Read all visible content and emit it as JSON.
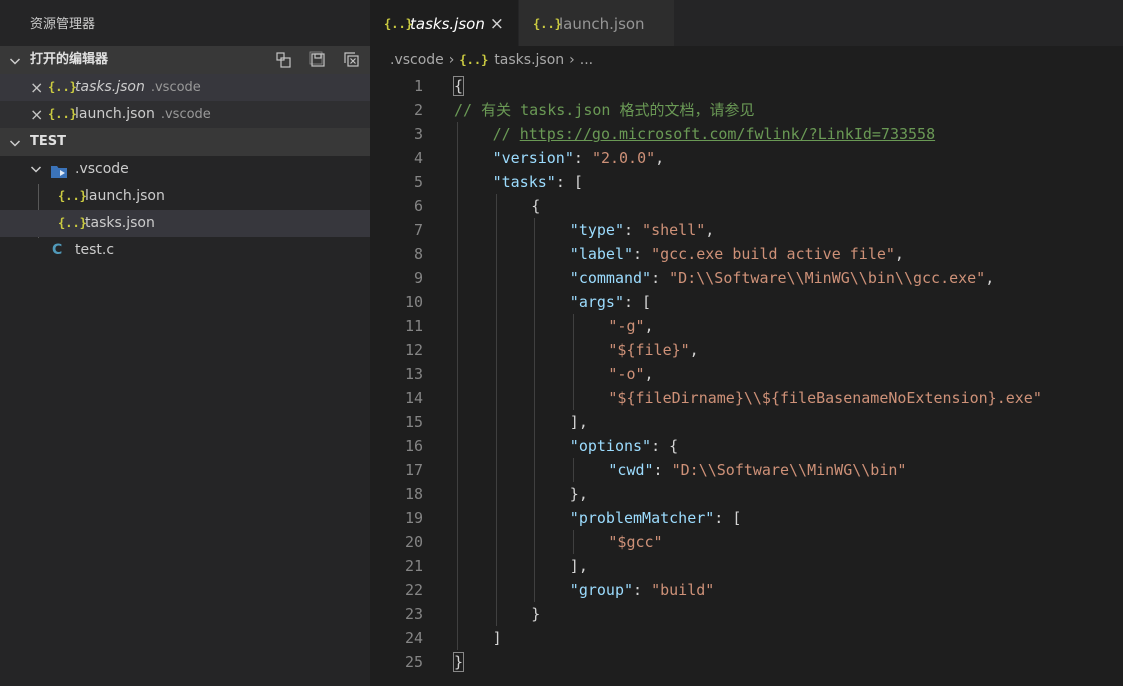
{
  "sidebar": {
    "title": "资源管理器",
    "open_editors": {
      "label": "打开的编辑器",
      "items": [
        {
          "name": "tasks.json",
          "dir": ".vscode"
        },
        {
          "name": "launch.json",
          "dir": ".vscode"
        }
      ]
    },
    "workspace": {
      "label": "TEST",
      "folder": ".vscode",
      "folder_children": [
        "launch.json",
        "tasks.json"
      ],
      "files": [
        "test.c"
      ]
    }
  },
  "tabs": [
    {
      "label": "tasks.json",
      "active": true
    },
    {
      "label": "launch.json",
      "active": false
    }
  ],
  "breadcrumb": {
    "folder": ".vscode",
    "file": "tasks.json",
    "more": "..."
  },
  "editor": {
    "lines": [
      {
        "n": "1",
        "p1": "{"
      },
      {
        "n": "2",
        "c": "// 有关 tasks.json 格式的文档，请参见"
      },
      {
        "n": "3",
        "c": "// ",
        "url": "https://go.microsoft.com/fwlink/?LinkId=733558"
      },
      {
        "n": "4",
        "k": "\"version\"",
        "p1": ": ",
        "s": "\"2.0.0\"",
        "p2": ","
      },
      {
        "n": "5",
        "k": "\"tasks\"",
        "p1": ": ["
      },
      {
        "n": "6",
        "p1": "{"
      },
      {
        "n": "7",
        "k": "\"type\"",
        "p1": ": ",
        "s": "\"shell\"",
        "p2": ","
      },
      {
        "n": "8",
        "k": "\"label\"",
        "p1": ": ",
        "s": "\"gcc.exe build active file\"",
        "p2": ","
      },
      {
        "n": "9",
        "k": "\"command\"",
        "p1": ": ",
        "s": "\"D:\\\\Software\\\\MinWG\\\\bin\\\\gcc.exe\"",
        "p2": ","
      },
      {
        "n": "10",
        "k": "\"args\"",
        "p1": ": ["
      },
      {
        "n": "11",
        "s": "\"-g\"",
        "p2": ","
      },
      {
        "n": "12",
        "s": "\"${file}\"",
        "p2": ","
      },
      {
        "n": "13",
        "s": "\"-o\"",
        "p2": ","
      },
      {
        "n": "14",
        "s": "\"${fileDirname}\\\\${fileBasenameNoExtension}.exe\""
      },
      {
        "n": "15",
        "p1": "],"
      },
      {
        "n": "16",
        "k": "\"options\"",
        "p1": ": {"
      },
      {
        "n": "17",
        "k": "\"cwd\"",
        "p1": ": ",
        "s": "\"D:\\\\Software\\\\MinWG\\\\bin\""
      },
      {
        "n": "18",
        "p1": "},"
      },
      {
        "n": "19",
        "k": "\"problemMatcher\"",
        "p1": ": ["
      },
      {
        "n": "20",
        "s": "\"$gcc\""
      },
      {
        "n": "21",
        "p1": "],"
      },
      {
        "n": "22",
        "k": "\"group\"",
        "p1": ": ",
        "s": "\"build\""
      },
      {
        "n": "23",
        "p1": "}"
      },
      {
        "n": "24",
        "p1": "]"
      },
      {
        "n": "25",
        "p1": "}"
      }
    ]
  }
}
